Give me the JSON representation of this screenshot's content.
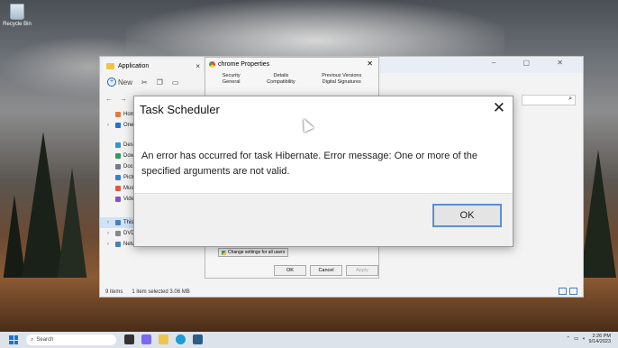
{
  "desktop": {
    "recycle_label": "Recycle Bin"
  },
  "explorer": {
    "tab_label": "Application",
    "new_label": "New",
    "nav_items": [
      "Home",
      "OneD",
      "Desk",
      "Dow",
      "Docu",
      "Pictu",
      "Musi",
      "Vide",
      "This",
      "DVD Drive (D:) CCC",
      "Network"
    ],
    "status_items": "9 items",
    "status_selected": "1 item selected  3.06 MB"
  },
  "properties": {
    "title": "chrome Properties",
    "tabs": [
      {
        "top": "Security",
        "bottom": "General"
      },
      {
        "top": "Details",
        "bottom": "Compatibility"
      },
      {
        "top": "Previous Versions",
        "bottom": "Digital Signatures"
      }
    ],
    "change_settings": "Change settings for all users",
    "ok": "OK",
    "cancel": "Cancel",
    "apply": "Apply"
  },
  "dialog": {
    "title": "Task Scheduler",
    "close_glyph": "✕",
    "message": "An error has occurred for task Hibernate. Error message: One or more of the specified arguments are not valid.",
    "ok_label": "OK"
  },
  "taskbar": {
    "search_placeholder": "Search",
    "time": "2:26 PM",
    "date": "9/14/2023"
  }
}
